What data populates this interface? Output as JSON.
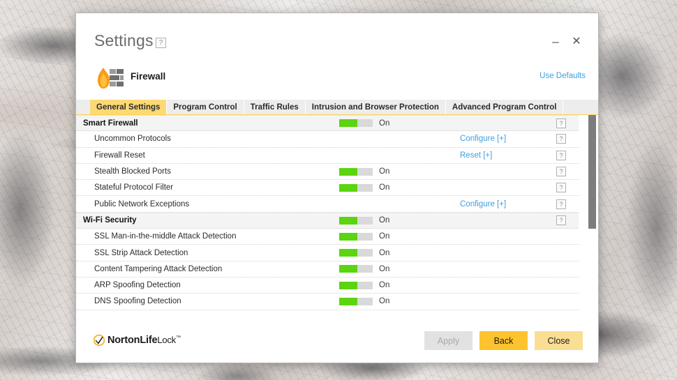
{
  "window": {
    "title": "Settings",
    "title_help_label": "?",
    "minimize_label": "–",
    "close_label": "✕"
  },
  "module": {
    "icon": "firewall-flame-wall-icon",
    "name": "Firewall",
    "use_defaults_label": "Use Defaults"
  },
  "tabs": [
    {
      "label": "General Settings",
      "active": true
    },
    {
      "label": "Program Control",
      "active": false
    },
    {
      "label": "Traffic Rules",
      "active": false
    },
    {
      "label": "Intrusion and Browser Protection",
      "active": false
    },
    {
      "label": "Advanced Program Control",
      "active": false
    }
  ],
  "settings_rows": [
    {
      "label": "Smart Firewall",
      "type": "section",
      "toggle": "On",
      "action": null,
      "help": "?"
    },
    {
      "label": "Uncommon Protocols",
      "type": "child",
      "toggle": null,
      "action": "Configure [+]",
      "help": "?"
    },
    {
      "label": "Firewall Reset",
      "type": "child",
      "toggle": null,
      "action": "Reset [+]",
      "help": "?"
    },
    {
      "label": "Stealth Blocked Ports",
      "type": "child",
      "toggle": "On",
      "action": null,
      "help": "?"
    },
    {
      "label": "Stateful Protocol Filter",
      "type": "child",
      "toggle": "On",
      "action": null,
      "help": "?"
    },
    {
      "label": "Public Network Exceptions",
      "type": "child",
      "toggle": null,
      "action": "Configure [+]",
      "help": "?"
    },
    {
      "label": "Wi-Fi Security",
      "type": "section",
      "toggle": "On",
      "action": null,
      "help": "?"
    },
    {
      "label": "SSL Man-in-the-middle Attack Detection",
      "type": "child",
      "toggle": "On",
      "action": null,
      "help": null
    },
    {
      "label": "SSL Strip Attack Detection",
      "type": "child",
      "toggle": "On",
      "action": null,
      "help": null
    },
    {
      "label": "Content Tampering Attack Detection",
      "type": "child",
      "toggle": "On",
      "action": null,
      "help": null
    },
    {
      "label": "ARP Spoofing Detection",
      "type": "child",
      "toggle": "On",
      "action": null,
      "help": null
    },
    {
      "label": "DNS Spoofing Detection",
      "type": "child",
      "toggle": "On",
      "action": null,
      "help": null
    }
  ],
  "footer": {
    "brand": {
      "name_part1": "Norton",
      "name_part2": "Life",
      "name_part3": "Lock",
      "trademark": "™"
    },
    "buttons": [
      {
        "label": "Apply",
        "style": "disabled"
      },
      {
        "label": "Back",
        "style": "primary"
      },
      {
        "label": "Close",
        "style": "secondary"
      }
    ]
  },
  "colors": {
    "accent_amber": "#fdc32f",
    "accent_amber_light": "#fade92",
    "tab_active": "#fdd976",
    "toggle_on_green": "#5cd410",
    "link_blue": "#3c9ee0",
    "scrollbar_thumb": "#7d7d7d"
  }
}
